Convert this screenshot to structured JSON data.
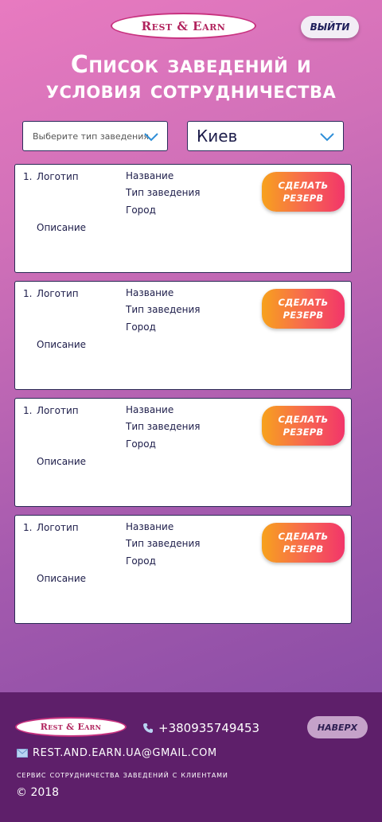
{
  "header": {
    "logo_text": "Rest & Earn",
    "logout_label": "ВЫЙТИ",
    "title_line1": "Список заведений и",
    "title_line2": "условия сотрудничества"
  },
  "filters": {
    "type_placeholder": "Выберите тип заведения",
    "city_value": "Киев"
  },
  "cards": [
    {
      "num": "1.",
      "logo": "Логотип",
      "name": "Название",
      "type": "Тип заведения",
      "city": "Город",
      "description": "Описание",
      "reserve": "СДЕЛАТЬ РЕЗЕРВ"
    },
    {
      "num": "1.",
      "logo": "Логотип",
      "name": "Название",
      "type": "Тип заведения",
      "city": "Город",
      "description": "Описание",
      "reserve": "СДЕЛАТЬ РЕЗЕРВ"
    },
    {
      "num": "1.",
      "logo": "Логотип",
      "name": "Название",
      "type": "Тип заведения",
      "city": "Город",
      "description": "Описание",
      "reserve": "СДЕЛАТЬ РЕЗЕРВ"
    },
    {
      "num": "1.",
      "logo": "Логотип",
      "name": "Название",
      "type": "Тип заведения",
      "city": "Город",
      "description": "Описание",
      "reserve": "СДЕЛАТЬ РЕЗЕРВ"
    }
  ],
  "footer": {
    "logo_text": "Rest & Earn",
    "phone": "+380935749453",
    "up_label": "НАВЕРХ",
    "email": "REST.AND.EARN.UA@GMAIL.COM",
    "slogan": "сервис сотрудничества заведений с клиентами",
    "copyright": "© 2018"
  },
  "icons": {
    "chevron": "chevron-down-icon",
    "phone": "phone-icon",
    "mail": "mail-icon"
  },
  "colors": {
    "accent_start": "#f7a21d",
    "accent_end": "#f2356a",
    "footer_bg": "#5e1f6a",
    "chevron": "#2f8fd8"
  }
}
